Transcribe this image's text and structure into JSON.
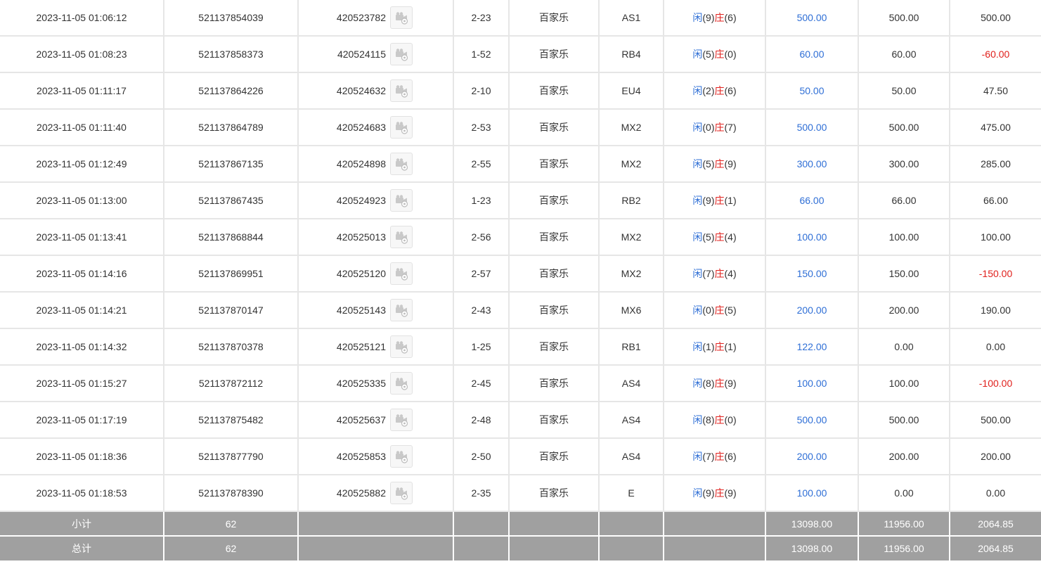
{
  "colors": {
    "player": "#2f6fd6",
    "banker": "#e0201c",
    "bet": "#2f6fd6",
    "negative": "#e0201c",
    "summary_bg": "#a0a0a0"
  },
  "labels": {
    "player": "闲",
    "banker": "庄"
  },
  "icons": {
    "video": "video-replay-icon"
  },
  "rows": [
    {
      "time": "2023-11-05 01:06:12",
      "order": "521137854039",
      "round": "420523782",
      "shoe": "2-23",
      "game": "百家乐",
      "table": "AS1",
      "p": "9",
      "b": "6",
      "bet": "500.00",
      "valid": "500.00",
      "win": "500.00",
      "neg": false
    },
    {
      "time": "2023-11-05 01:08:23",
      "order": "521137858373",
      "round": "420524115",
      "shoe": "1-52",
      "game": "百家乐",
      "table": "RB4",
      "p": "5",
      "b": "0",
      "bet": "60.00",
      "valid": "60.00",
      "win": "-60.00",
      "neg": true
    },
    {
      "time": "2023-11-05 01:11:17",
      "order": "521137864226",
      "round": "420524632",
      "shoe": "2-10",
      "game": "百家乐",
      "table": "EU4",
      "p": "2",
      "b": "6",
      "bet": "50.00",
      "valid": "50.00",
      "win": "47.50",
      "neg": false
    },
    {
      "time": "2023-11-05 01:11:40",
      "order": "521137864789",
      "round": "420524683",
      "shoe": "2-53",
      "game": "百家乐",
      "table": "MX2",
      "p": "0",
      "b": "7",
      "bet": "500.00",
      "valid": "500.00",
      "win": "475.00",
      "neg": false
    },
    {
      "time": "2023-11-05 01:12:49",
      "order": "521137867135",
      "round": "420524898",
      "shoe": "2-55",
      "game": "百家乐",
      "table": "MX2",
      "p": "5",
      "b": "9",
      "bet": "300.00",
      "valid": "300.00",
      "win": "285.00",
      "neg": false
    },
    {
      "time": "2023-11-05 01:13:00",
      "order": "521137867435",
      "round": "420524923",
      "shoe": "1-23",
      "game": "百家乐",
      "table": "RB2",
      "p": "9",
      "b": "1",
      "bet": "66.00",
      "valid": "66.00",
      "win": "66.00",
      "neg": false
    },
    {
      "time": "2023-11-05 01:13:41",
      "order": "521137868844",
      "round": "420525013",
      "shoe": "2-56",
      "game": "百家乐",
      "table": "MX2",
      "p": "5",
      "b": "4",
      "bet": "100.00",
      "valid": "100.00",
      "win": "100.00",
      "neg": false
    },
    {
      "time": "2023-11-05 01:14:16",
      "order": "521137869951",
      "round": "420525120",
      "shoe": "2-57",
      "game": "百家乐",
      "table": "MX2",
      "p": "7",
      "b": "4",
      "bet": "150.00",
      "valid": "150.00",
      "win": "-150.00",
      "neg": true
    },
    {
      "time": "2023-11-05 01:14:21",
      "order": "521137870147",
      "round": "420525143",
      "shoe": "2-43",
      "game": "百家乐",
      "table": "MX6",
      "p": "0",
      "b": "5",
      "bet": "200.00",
      "valid": "200.00",
      "win": "190.00",
      "neg": false
    },
    {
      "time": "2023-11-05 01:14:32",
      "order": "521137870378",
      "round": "420525121",
      "shoe": "1-25",
      "game": "百家乐",
      "table": "RB1",
      "p": "1",
      "b": "1",
      "bet": "122.00",
      "valid": "0.00",
      "win": "0.00",
      "neg": false
    },
    {
      "time": "2023-11-05 01:15:27",
      "order": "521137872112",
      "round": "420525335",
      "shoe": "2-45",
      "game": "百家乐",
      "table": "AS4",
      "p": "8",
      "b": "9",
      "bet": "100.00",
      "valid": "100.00",
      "win": "-100.00",
      "neg": true
    },
    {
      "time": "2023-11-05 01:17:19",
      "order": "521137875482",
      "round": "420525637",
      "shoe": "2-48",
      "game": "百家乐",
      "table": "AS4",
      "p": "8",
      "b": "0",
      "bet": "500.00",
      "valid": "500.00",
      "win": "500.00",
      "neg": false
    },
    {
      "time": "2023-11-05 01:18:36",
      "order": "521137877790",
      "round": "420525853",
      "shoe": "2-50",
      "game": "百家乐",
      "table": "AS4",
      "p": "7",
      "b": "6",
      "bet": "200.00",
      "valid": "200.00",
      "win": "200.00",
      "neg": false
    },
    {
      "time": "2023-11-05 01:18:53",
      "order": "521137878390",
      "round": "420525882",
      "shoe": "2-35",
      "game": "百家乐",
      "table": "E",
      "p": "9",
      "b": "9",
      "bet": "100.00",
      "valid": "0.00",
      "win": "0.00",
      "neg": false
    }
  ],
  "subtotal": {
    "label": "小计",
    "count": "62",
    "bet": "13098.00",
    "valid": "11956.00",
    "win": "2064.85"
  },
  "total": {
    "label": "总计",
    "count": "62",
    "bet": "13098.00",
    "valid": "11956.00",
    "win": "2064.85"
  }
}
